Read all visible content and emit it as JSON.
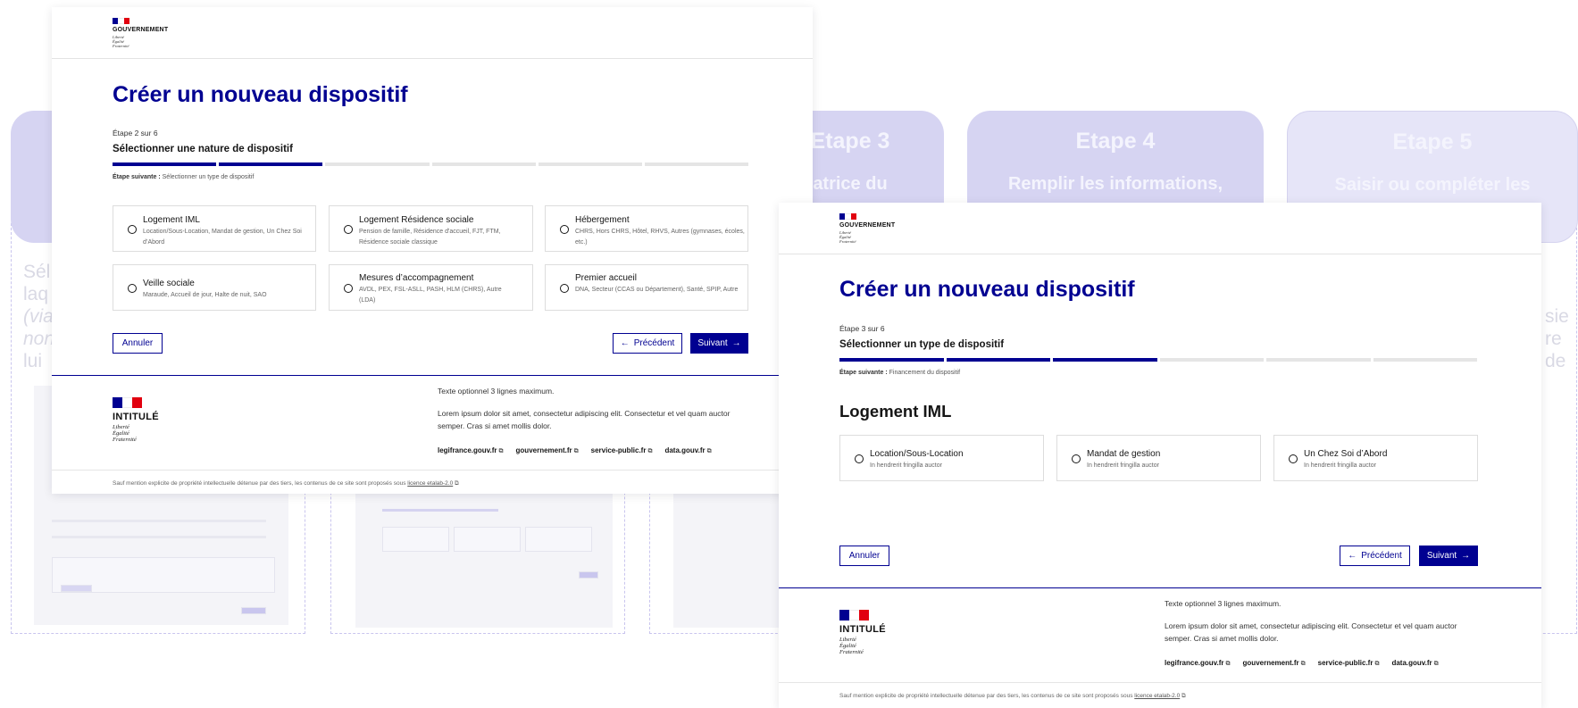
{
  "background": {
    "steps": [
      {
        "title": "",
        "desc": ""
      },
      {
        "title": "Etape 3",
        "desc": "atrice du"
      },
      {
        "title": "Etape 4",
        "desc": "Remplir les informations,"
      },
      {
        "title": "Etape 5",
        "desc": "Saisir ou compléter les"
      }
    ],
    "ghost_left_lines": [
      "Sél",
      "laq",
      "(via",
      "non",
      "lui"
    ],
    "ghost_right_lines": [
      "sie",
      "re",
      "de"
    ]
  },
  "screen_a": {
    "header": {
      "gov_label": "GOUVERNEMENT",
      "motto": [
        "Liberté",
        "Égalité",
        "Fraternité"
      ]
    },
    "page_title": "Créer un nouveau dispositif",
    "step_label": "Étape 2 sur 6",
    "step_title": "Sélectionner une nature de dispositif",
    "progress": {
      "current": 2,
      "total": 6
    },
    "next_step_label": "Étape suivante :",
    "next_step_value": "Sélectionner un type de dispositif",
    "options": [
      {
        "title": "Logement IML",
        "desc": "Location/Sous-Location, Mandat de gestion, Un Chez Soi d’Abord"
      },
      {
        "title": "Logement Résidence sociale",
        "desc": "Pension de famille, Résidence d'accueil, FJT, FTM, Résidence sociale classique"
      },
      {
        "title": "Hébergement",
        "desc": "CHRS, Hors CHRS, Hôtel, RHVS, Autres (gymnases, écoles, etc.)"
      },
      {
        "title": "Veille sociale",
        "desc": "Maraude, Accueil de jour, Halte de nuit, SAO"
      },
      {
        "title": "Mesures d’accompagnement",
        "desc": "AVDL, PEX, FSL-ASLL, PASH, HLM (CHRS), Autre (LDA)"
      },
      {
        "title": "Premier accueil",
        "desc": "DNA, Secteur (CCAS ou Département), Santé, SPIP, Autre"
      }
    ],
    "buttons": {
      "cancel": "Annuler",
      "previous": "Précédent",
      "next": "Suivant"
    },
    "footer": {
      "intitule": "INTITULÉ",
      "motto": [
        "Liberté",
        "Égalité",
        "Fraternité"
      ],
      "optional_text": "Texte optionnel 3 lignes maximum.",
      "body_text": "Lorem ipsum dolor sit amet, consectetur adipiscing elit. Consectetur et vel quam auctor semper. Cras si amet mollis dolor.",
      "links": [
        "legifrance.gouv.fr",
        "gouvernement.fr",
        "service-public.fr",
        "data.gouv.fr"
      ],
      "bottom_text": "Sauf mention explicite de propriété intellectuelle détenue par des tiers, les contenus de ce site sont proposés sous",
      "license_link": "licence etalab-2.0"
    }
  },
  "screen_b": {
    "header": {
      "gov_label": "GOUVERNEMENT",
      "motto": [
        "Liberté",
        "Égalité",
        "Fraternité"
      ]
    },
    "page_title": "Créer un nouveau dispositif",
    "step_label": "Étape 3 sur 6",
    "step_title": "Sélectionner un type de dispositif",
    "progress": {
      "current": 3,
      "total": 6
    },
    "next_step_label": "Étape suivante :",
    "next_step_value": "Financement du dispositif",
    "section_title": "Logement IML",
    "options": [
      {
        "title": "Location/Sous-Location",
        "desc": "In hendrerit fringilla auctor"
      },
      {
        "title": "Mandat de gestion",
        "desc": "In hendrerit fringilla auctor"
      },
      {
        "title": "Un Chez Soi d’Abord",
        "desc": "In hendrerit fringilla auctor"
      }
    ],
    "buttons": {
      "cancel": "Annuler",
      "previous": "Précédent",
      "next": "Suivant"
    },
    "footer": {
      "intitule": "INTITULÉ",
      "motto": [
        "Liberté",
        "Égalité",
        "Fraternité"
      ],
      "optional_text": "Texte optionnel 3 lignes maximum.",
      "body_text": "Lorem ipsum dolor sit amet, consectetur adipiscing elit. Consectetur et vel quam auctor semper. Cras si amet mollis dolor.",
      "links": [
        "legifrance.gouv.fr",
        "gouvernement.fr",
        "service-public.fr",
        "data.gouv.fr"
      ],
      "bottom_text": "Sauf mention explicite de propriété intellectuelle détenue par des tiers, les contenus de ce site sont proposés sous",
      "license_link": "licence etalab-2.0"
    }
  },
  "colors": {
    "primary": "#000091",
    "flag_blue": "#000091",
    "flag_white": "#ffffff",
    "flag_red": "#e1000f",
    "step_card": "#d6d4f2"
  },
  "icons": {
    "arrow_left": "arrow-left-icon",
    "arrow_right": "arrow-right-icon",
    "external_link": "external-link-icon",
    "radio": "radio-icon"
  }
}
